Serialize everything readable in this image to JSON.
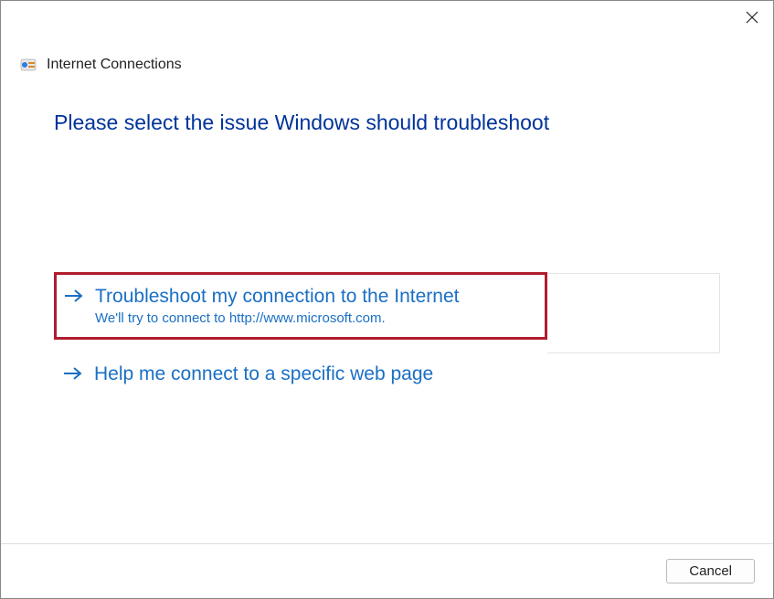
{
  "window": {
    "title": "Internet Connections"
  },
  "heading": "Please select the issue Windows should troubleshoot",
  "options": [
    {
      "title": "Troubleshoot my connection to the Internet",
      "subtitle": "We'll try to connect to http://www.microsoft.com."
    },
    {
      "title": "Help me connect to a specific web page",
      "subtitle": ""
    }
  ],
  "footer": {
    "cancel_label": "Cancel"
  }
}
